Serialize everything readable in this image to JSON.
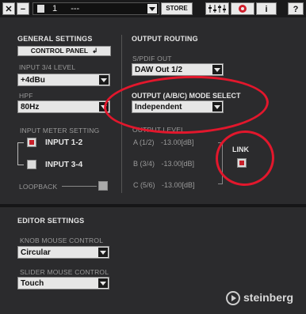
{
  "topbar": {
    "close_glyph": "✕",
    "minimize_glyph": "−",
    "preset_number": "1",
    "preset_name": "---",
    "store_label": "STORE",
    "info_glyph": "i",
    "help_glyph": "?"
  },
  "general": {
    "heading": "GENERAL SETTINGS",
    "control_panel_label": "CONTROL PANEL",
    "input34_label": "INPUT 3/4 LEVEL",
    "input34_value": "+4dBu",
    "hpf_label": "HPF",
    "hpf_value": "80Hz",
    "meter_heading": "INPUT METER SETTING",
    "meter_input12": "INPUT 1-2",
    "meter_input34": "INPUT 3-4",
    "loopback_label": "LOOPBACK"
  },
  "output": {
    "heading": "OUTPUT ROUTING",
    "spdif_label": "S/PDIF OUT",
    "spdif_value": "DAW Out 1/2",
    "mode_label": "OUTPUT (A/B/C) MODE SELECT",
    "mode_value": "Independent",
    "level_label": "OUTPUT LEVEL",
    "rows": [
      {
        "name": "A (1/2)",
        "value": "-13.00[dB]"
      },
      {
        "name": "B (3/4)",
        "value": "-13.00[dB]"
      },
      {
        "name": "C (5/6)",
        "value": "-13.00[dB]"
      }
    ],
    "link_label": "LINK"
  },
  "editor": {
    "heading": "EDITOR SETTINGS",
    "knob_label": "KNOB MOUSE CONTROL",
    "knob_value": "Circular",
    "slider_label": "SLIDER MOUSE CONTROL",
    "slider_value": "Touch"
  },
  "brand": "steinberg",
  "colors": {
    "annotation": "#e2172c",
    "checkbox_on": "#c8202a",
    "background": "#2b2b2d"
  }
}
